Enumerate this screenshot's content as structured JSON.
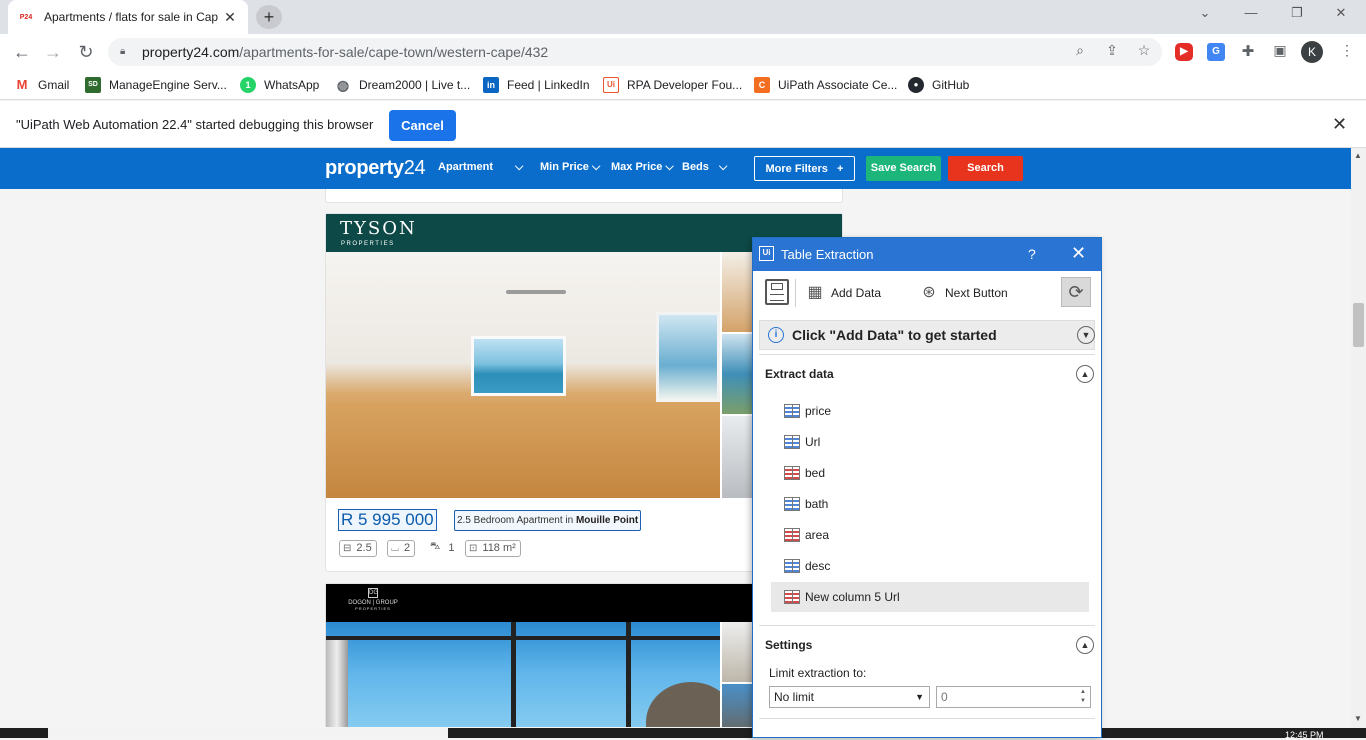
{
  "browser": {
    "tab_title": "Apartments / flats for sale in Cap",
    "tab_favicon": "P24",
    "url_host": "property24.com",
    "url_path": "/apartments-for-sale/cape-town/western-cape/432",
    "avatar_letter": "K",
    "bookmarks": [
      {
        "label": "Gmail",
        "icon": "gmail-icon",
        "glyph": "M",
        "color": "#ea4335"
      },
      {
        "label": "ManageEngine Serv...",
        "icon": "manageengine-icon",
        "glyph": "SD",
        "color": "#2f6b2f"
      },
      {
        "label": "WhatsApp",
        "icon": "whatsapp-icon",
        "glyph": "1",
        "color": "#25d366"
      },
      {
        "label": "Dream2000 | Live t...",
        "icon": "globe-icon",
        "glyph": "◍",
        "color": "#5f6368"
      },
      {
        "label": "Feed | LinkedIn",
        "icon": "linkedin-icon",
        "glyph": "in",
        "color": "#0a66c2"
      },
      {
        "label": "RPA Developer Fou...",
        "icon": "uipath-icon",
        "glyph": "Ui",
        "color": "#e8542c"
      },
      {
        "label": "UiPath Associate Ce...",
        "icon": "uipath-c-icon",
        "glyph": "C",
        "color": "#f36e21"
      },
      {
        "label": "GitHub",
        "icon": "github-icon",
        "glyph": "●",
        "color": "#24292f"
      }
    ]
  },
  "infobar": {
    "message": "\"UiPath Web Automation 22.4\" started debugging this browser",
    "cancel_label": "Cancel"
  },
  "site": {
    "logo_bold": "property",
    "logo_num": "24",
    "nav": [
      {
        "label": "Apartment"
      },
      {
        "label": "Min Price"
      },
      {
        "label": "Max Price"
      },
      {
        "label": "Beds"
      }
    ],
    "more_filters": "More Filters",
    "save_search": "Save Search",
    "search": "Search",
    "accent_blue": "#0b6dcb",
    "save_green": "#1db67a",
    "search_red": "#e8341c"
  },
  "listing1": {
    "agency": "TYSON",
    "agency_sub": "PROPERTIES",
    "price": "R 5 995 000",
    "title_prefix": "2.5 Bedroom Apartment in ",
    "title_place": "Mouille Point",
    "beds": "2.5",
    "baths": "2",
    "parking": "1",
    "area": "118 m²"
  },
  "listing2": {
    "agency_line1": "DOGON",
    "agency_mark": "DG",
    "agency_line2": "DOGON | GROUP",
    "agency_line3": "PROPERTIES"
  },
  "table_extraction": {
    "title": "Table Extraction",
    "help": "?",
    "add_data": "Add Data",
    "next_button": "Next Button",
    "banner": "Click \"Add Data\" to get started",
    "extract_heading": "Extract data",
    "columns": [
      {
        "name": "price",
        "icon": "blue"
      },
      {
        "name": "Url",
        "icon": "blue"
      },
      {
        "name": "bed",
        "icon": "red"
      },
      {
        "name": "bath",
        "icon": "blue"
      },
      {
        "name": "area",
        "icon": "red"
      },
      {
        "name": "desc",
        "icon": "blue"
      },
      {
        "name": "New column 5 Url",
        "icon": "red",
        "selected": true
      }
    ],
    "settings_heading": "Settings",
    "limit_label": "Limit extraction to:",
    "limit_value": "No limit",
    "limit_count": "0"
  },
  "taskbar": {
    "time": "12:45 PM"
  }
}
